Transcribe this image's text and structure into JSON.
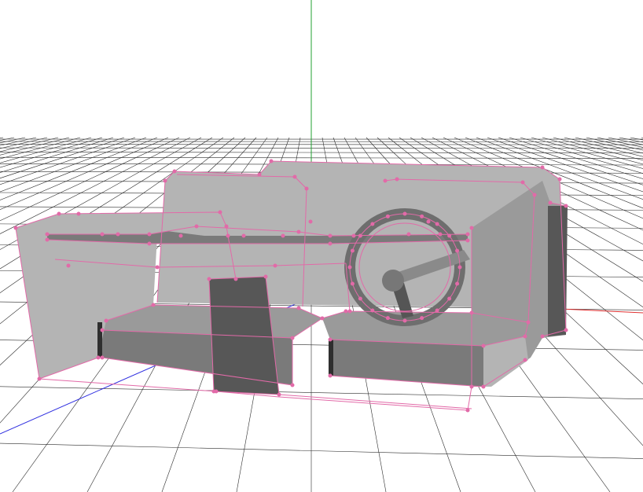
{
  "viewport": {
    "background": "#ffffff",
    "colors": {
      "grid": "#2a2a2a",
      "axis_x": "#e03030",
      "axis_y": "#22a030",
      "axis_z": "#3030e0",
      "wireframe": "#e26aa8",
      "vertex": "#e26aa8",
      "solid_light": "#b4b4b4",
      "solid_mid": "#9a9a9a",
      "solid_dark": "#7a7a7a",
      "solid_darker": "#575757"
    },
    "model": "sofa-mesh",
    "grid_visible": true,
    "axes_visible": true
  }
}
